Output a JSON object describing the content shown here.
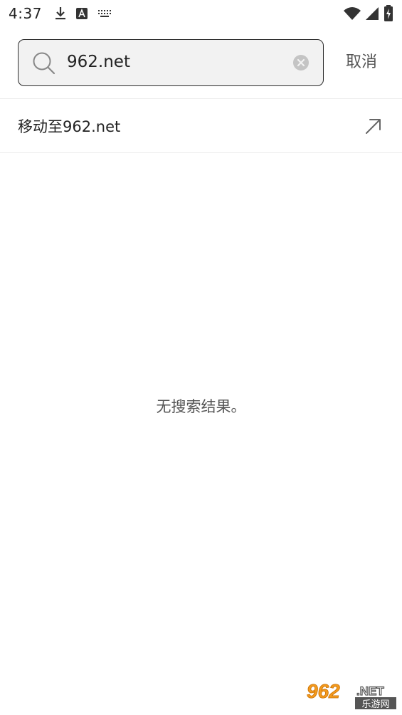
{
  "status_bar": {
    "time": "4:37",
    "left_icons": [
      "download-icon",
      "a-app-icon",
      "keyboard-icon"
    ],
    "right_icons": [
      "wifi-icon",
      "cell-signal-icon",
      "battery-charging-icon"
    ]
  },
  "search": {
    "value": "962.net",
    "cancel_label": "取消"
  },
  "suggestion": {
    "move_to_label": "移动至962.net"
  },
  "results": {
    "empty_message": "无搜索结果。"
  },
  "watermark": {
    "logo_text": "962.NET",
    "sub_text": "乐游网"
  },
  "colors": {
    "border": "#2b2b2b",
    "search_bg": "#f2f2f2",
    "secondary_text": "#555555",
    "watermark_orange": "#f39a1e"
  }
}
